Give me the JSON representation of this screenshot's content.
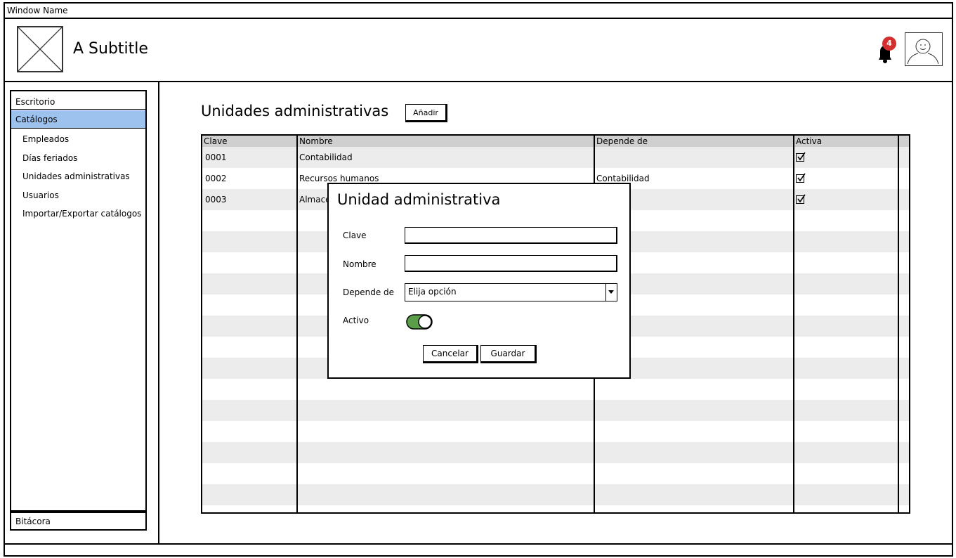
{
  "window": {
    "title": "Window Name"
  },
  "header": {
    "subtitle": "A Subtitle",
    "notification_count": "4"
  },
  "sidebar": {
    "items": [
      {
        "label": "Escritorio"
      },
      {
        "label": "Catálogos",
        "selected": true
      },
      {
        "label": "Empleados"
      },
      {
        "label": "Días feriados"
      },
      {
        "label": "Unidades administrativas"
      },
      {
        "label": "Usuarios"
      },
      {
        "label": "Importar/Exportar catálogos"
      }
    ],
    "footer_item": "Bitácora"
  },
  "main": {
    "title": "Unidades administrativas",
    "add_label": "Añadir"
  },
  "table": {
    "columns": [
      "Clave",
      "Nombre",
      "Depende de",
      "Activa"
    ],
    "rows": [
      {
        "clave": "0001",
        "nombre": "Contabilidad",
        "depende": "",
        "activa": true
      },
      {
        "clave": "0002",
        "nombre": "Recursos humanos",
        "depende": "Contabilidad",
        "activa": true
      },
      {
        "clave": "0003",
        "nombre": "Almacé",
        "depende": "",
        "activa": true
      }
    ]
  },
  "dialog": {
    "title": "Unidad administrativa",
    "clave_label": "Clave",
    "clave_value": "",
    "nombre_label": "Nombre",
    "nombre_value": "",
    "depende_label": "Depende de",
    "depende_value": "Elija opción",
    "activo_label": "Activo",
    "activo_on": true,
    "cancel_label": "Cancelar",
    "save_label": "Guardar"
  },
  "colors": {
    "selected": "#9ec2ee",
    "badge": "#d32f2f",
    "toggle_on": "#5a9e4a",
    "row_alt": "#ececec",
    "header": "#cfcfcf"
  }
}
